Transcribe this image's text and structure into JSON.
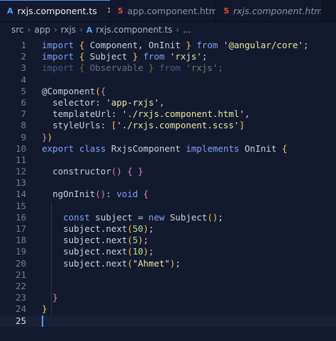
{
  "tabs": [
    {
      "icon": "A",
      "label": "rxjs.component.ts",
      "active": true,
      "italic": false,
      "close": "✕"
    },
    {
      "icon": "5",
      "label": "app.component.html",
      "active": false,
      "italic": false
    },
    {
      "icon": "5",
      "label": "rxjs.component.html",
      "active": false,
      "italic": true
    }
  ],
  "breadcrumb": {
    "parts": [
      "src",
      "app",
      "rxjs"
    ],
    "file": "rxjs.component.ts",
    "ellipsis": "..."
  },
  "code": {
    "line_numbers": [
      "1",
      "2",
      "3",
      "4",
      "5",
      "6",
      "7",
      "8",
      "9",
      "10",
      "11",
      "12",
      "13",
      "14",
      "15",
      "16",
      "17",
      "18",
      "19",
      "20",
      "21",
      "22",
      "23",
      "24",
      "25"
    ],
    "l1": {
      "kw": "import",
      "b1": "{",
      "names": " Component, OnInit ",
      "b2": "}",
      "from": "from",
      "str": "'@angular/core'",
      "end": ";"
    },
    "l2": {
      "kw": "import",
      "b1": "{",
      "names": " Subject ",
      "b2": "}",
      "from": "from",
      "str": "'rxjs'",
      "end": ";"
    },
    "l3": {
      "kw": "import",
      "b1": "{",
      "names": " Observable ",
      "b2": "}",
      "from": "from",
      "str": "'rxjs'",
      "end": ";"
    },
    "l5": {
      "at": "@Component",
      "p": "(",
      "b": "{"
    },
    "l6": {
      "key": "selector",
      "colon": ": ",
      "str": "'app-rxjs'",
      "end": ","
    },
    "l7": {
      "key": "templateUrl",
      "colon": ": ",
      "str": "'./rxjs.component.html'",
      "end": ","
    },
    "l8": {
      "key": "styleUrls",
      "colon": ": ",
      "ob": "[",
      "str": "'./rxjs.component.scss'",
      "cb": "]"
    },
    "l9": {
      "b": "}",
      "p": ")"
    },
    "l10": {
      "export": "export",
      "class": "class",
      "name": "RxjsComponent",
      "implements": "implements",
      "iface": "OnInit",
      "b": "{"
    },
    "l12": {
      "fn": "constructor",
      "p": "()",
      "b1": "{",
      "b2": "}"
    },
    "l14": {
      "fn": "ngOnInit",
      "p": "()",
      "colon": ": ",
      "type": "void",
      "b": "{"
    },
    "l16": {
      "const": "const",
      "var": "subject",
      "eq": " = ",
      "new": "new",
      "cls": "Subject",
      "p": "()",
      "end": ";"
    },
    "l17": {
      "obj": "subject.",
      "m": "next",
      "p1": "(",
      "num": "50",
      "p2": ")",
      "end": ";"
    },
    "l18": {
      "obj": "subject.",
      "m": "next",
      "p1": "(",
      "num": "5",
      "p2": ")",
      "end": ";"
    },
    "l19": {
      "obj": "subject.",
      "m": "next",
      "p1": "(",
      "num": "10",
      "p2": ")",
      "end": ";"
    },
    "l20": {
      "obj": "subject.",
      "m": "next",
      "p1": "(",
      "str": "\"Ahmet\"",
      "p2": ")",
      "end": ";"
    },
    "l23": {
      "b": "}"
    },
    "l24": {
      "b": "}"
    }
  },
  "colors": {
    "background": "#141a2e",
    "keyword": "#7aa2f7",
    "string": "#e6e6a0",
    "number": "#b5e08a",
    "caret": "#4aa3ff"
  }
}
